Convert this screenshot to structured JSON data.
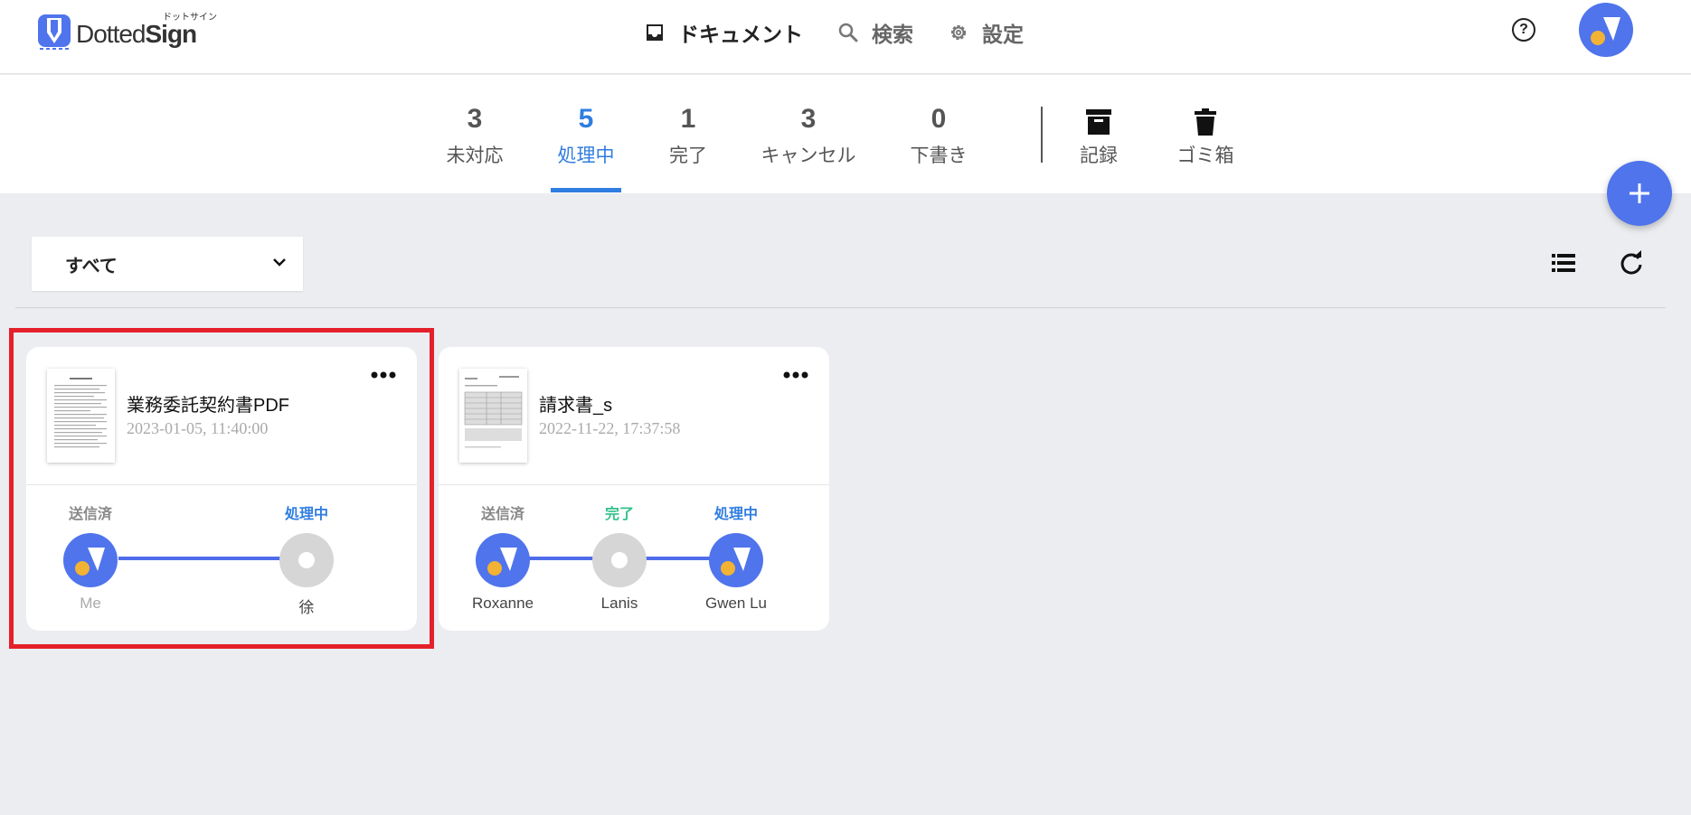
{
  "app": {
    "logo_text_a": "Dotted",
    "logo_text_b": "Sign",
    "logo_kana": "ドットサイン"
  },
  "nav": {
    "documents": "ドキュメント",
    "search": "検索",
    "settings": "設定",
    "help": "?"
  },
  "tabs": [
    {
      "count": "3",
      "label": "未対応"
    },
    {
      "count": "5",
      "label": "処理中"
    },
    {
      "count": "1",
      "label": "完了"
    },
    {
      "count": "3",
      "label": "キャンセル"
    },
    {
      "count": "0",
      "label": "下書き"
    }
  ],
  "tab_actions": [
    {
      "label": "記録",
      "icon": "archive-box-icon"
    },
    {
      "label": "ゴミ箱",
      "icon": "trash-icon"
    }
  ],
  "active_tab": "処理中",
  "filter": {
    "selected": "すべて"
  },
  "colors": {
    "accent": "#2f7de1",
    "brand": "#4f74ec",
    "done": "#32c08a",
    "highlight": "#e4202a",
    "avatar_dot": "#f2b233"
  },
  "cards": [
    {
      "title": "業務委託契約書PDF",
      "date": "2023-01-05, 11:40:00",
      "steps": [
        {
          "status": "送信済",
          "name": "Me"
        },
        {
          "status": "処理中",
          "name": "徐"
        }
      ]
    },
    {
      "title": "請求書_s",
      "date": "2022-11-22, 17:37:58",
      "steps": [
        {
          "status": "送信済",
          "name": "Roxanne"
        },
        {
          "status": "完了",
          "name": "Lanis"
        },
        {
          "status": "処理中",
          "name": "Gwen Lu"
        }
      ]
    }
  ]
}
